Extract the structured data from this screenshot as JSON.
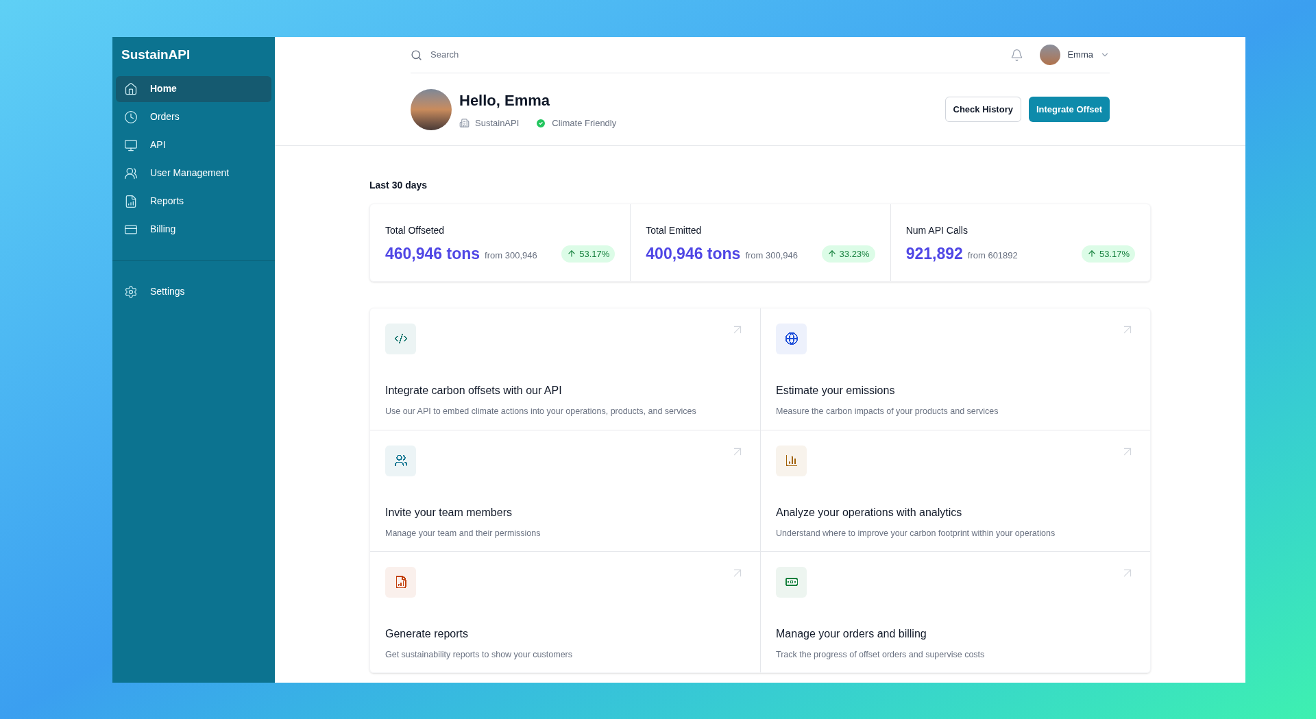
{
  "sidebar": {
    "brand": "SustainAPI",
    "items": [
      {
        "label": "Home",
        "selected": true
      },
      {
        "label": "Orders",
        "selected": false
      },
      {
        "label": "API",
        "selected": false
      },
      {
        "label": "User Management",
        "selected": false
      },
      {
        "label": "Reports",
        "selected": false
      },
      {
        "label": "Billing",
        "selected": false
      }
    ],
    "bottom_items": [
      {
        "label": "Settings",
        "selected": false
      }
    ]
  },
  "topbar": {
    "search": {
      "placeholder": "Search"
    },
    "user": "Emma"
  },
  "profile": {
    "greeting": "Hello, Emma",
    "company": "SustainAPI",
    "status": "Climate Friendly",
    "buttons": [
      "Check History",
      "Integrate Offset"
    ]
  },
  "period": "Last 30 days",
  "stats": [
    {
      "label": "Total Offseted",
      "value": "460,946 tons",
      "from": "from 300,946",
      "change": "53.17%"
    },
    {
      "label": "Total Emitted",
      "value": "400,946 tons",
      "from": "from 300,946",
      "change": "33.23%"
    },
    {
      "label": "Num API Calls",
      "value": "921,892",
      "from": "from 601892",
      "change": "53.17%"
    }
  ],
  "cards": [
    {
      "title": "Integrate carbon offsets with our API",
      "description": "Use our API to embed climate actions into your operations, products, and services",
      "color": "#0f766e"
    },
    {
      "title": "Estimate your emissions",
      "description": "Measure the carbon impacts of your products and services",
      "color": "#1d4ed8"
    },
    {
      "title": "Invite your team members",
      "description": "Manage your team and their permissions",
      "color": "#0e7490"
    },
    {
      "title": "Analyze your operations with analytics",
      "description": "Understand where to improve your carbon footprint within your operations",
      "color": "#a16207"
    },
    {
      "title": "Generate reports",
      "description": "Get sustainability reports to show your customers",
      "color": "#c2410c"
    },
    {
      "title": "Manage your orders and billing",
      "description": "Track the progress of offset orders and supervise costs",
      "color": "#15803d"
    }
  ]
}
